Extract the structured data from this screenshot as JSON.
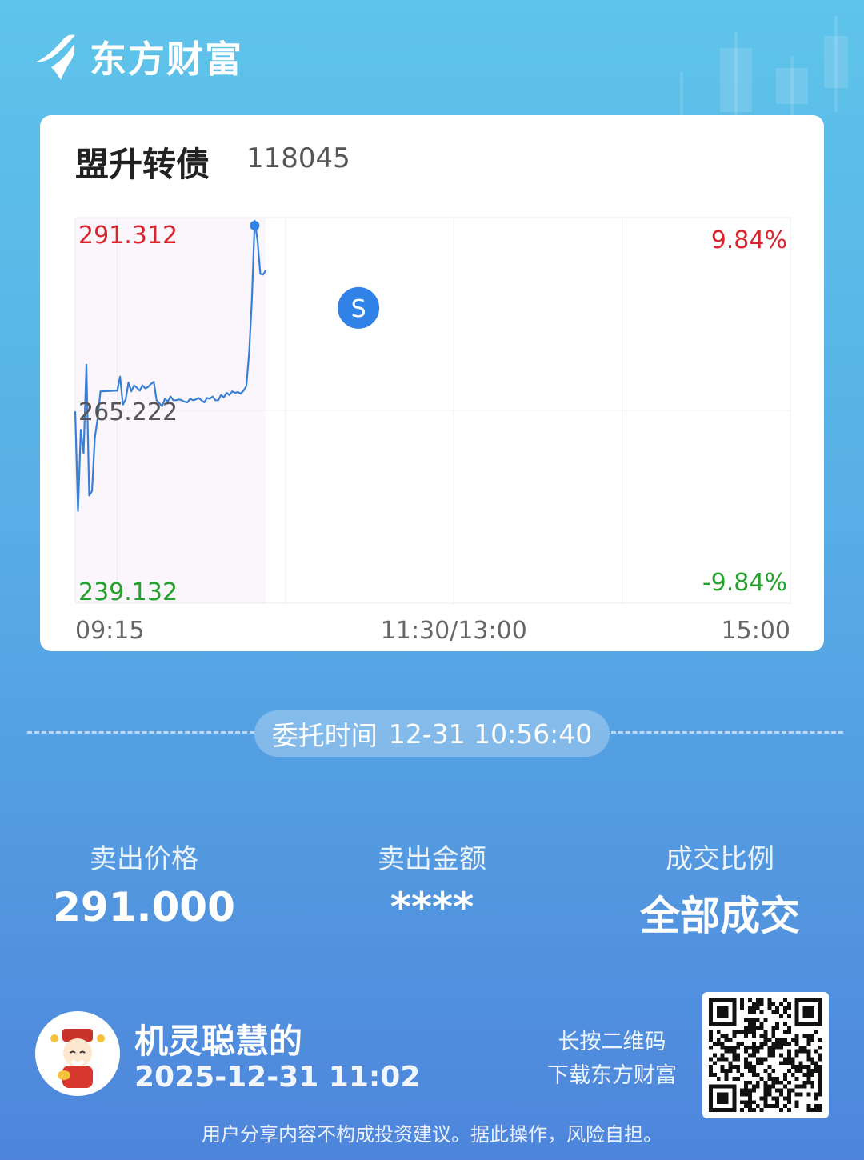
{
  "brand": {
    "name": "东方财富"
  },
  "stock": {
    "name": "盟升转债",
    "code": "118045"
  },
  "chart_data": {
    "type": "line",
    "y_labels": {
      "high": "291.312",
      "mid": "265.222",
      "low": "239.132"
    },
    "pct_labels": {
      "high": "9.84%",
      "low": "-9.84%"
    },
    "x_labels": [
      "09:15",
      "11:30/13:00",
      "15:00"
    ],
    "ylim": [
      239.132,
      291.312
    ],
    "prev_close": 265.222,
    "trade_marker": {
      "label": "S",
      "time": "10:56",
      "price": 291.0
    },
    "series": [
      {
        "values": [
          [
            "09:15",
            265.1
          ],
          [
            "09:16",
            251.6
          ],
          [
            "09:17",
            262.6
          ],
          [
            "09:18",
            259.4
          ],
          [
            "09:19",
            271.4
          ],
          [
            "09:20",
            253.7
          ],
          [
            "09:21",
            254.3
          ],
          [
            "09:22",
            261.5
          ],
          [
            "09:23",
            264.1
          ],
          [
            "09:24",
            267.8
          ],
          [
            "09:30",
            267.9
          ],
          [
            "09:31",
            269.8
          ],
          [
            "09:32",
            266.0
          ],
          [
            "09:33",
            266.7
          ],
          [
            "09:34",
            269.0
          ],
          [
            "09:35",
            267.8
          ],
          [
            "09:36",
            268.6
          ],
          [
            "09:37",
            268.3
          ],
          [
            "09:38",
            267.9
          ],
          [
            "09:39",
            268.6
          ],
          [
            "09:40",
            268.2
          ],
          [
            "09:41",
            268.4
          ],
          [
            "09:42",
            268.8
          ],
          [
            "09:43",
            269.1
          ],
          [
            "09:44",
            266.6
          ],
          [
            "09:45",
            266.2
          ],
          [
            "09:46",
            265.8
          ],
          [
            "09:47",
            266.8
          ],
          [
            "09:48",
            266.4
          ],
          [
            "09:49",
            267.1
          ],
          [
            "09:50",
            266.6
          ],
          [
            "09:51",
            266.6
          ],
          [
            "09:52",
            266.7
          ],
          [
            "09:53",
            266.6
          ],
          [
            "09:54",
            266.4
          ],
          [
            "09:55",
            266.3
          ],
          [
            "09:56",
            266.8
          ],
          [
            "09:57",
            266.6
          ],
          [
            "09:58",
            266.7
          ],
          [
            "09:59",
            266.9
          ],
          [
            "10:00",
            266.6
          ],
          [
            "10:01",
            266.3
          ],
          [
            "10:02",
            266.9
          ],
          [
            "10:03",
            266.8
          ],
          [
            "10:04",
            267.1
          ],
          [
            "10:05",
            266.6
          ],
          [
            "10:06",
            266.6
          ],
          [
            "10:07",
            267.3
          ],
          [
            "10:08",
            267.0
          ],
          [
            "10:09",
            267.6
          ],
          [
            "10:10",
            267.3
          ],
          [
            "10:11",
            267.8
          ],
          [
            "10:12",
            267.6
          ],
          [
            "10:13",
            267.7
          ],
          [
            "10:14",
            267.5
          ],
          [
            "10:15",
            267.9
          ],
          [
            "10:16",
            268.5
          ],
          [
            "10:17",
            273.0
          ],
          [
            "10:18",
            280.3
          ],
          [
            "10:19",
            290.9
          ],
          [
            "10:20",
            288.2
          ],
          [
            "10:21",
            283.7
          ],
          [
            "10:22",
            283.6
          ],
          [
            "10:23",
            284.2
          ]
        ]
      }
    ]
  },
  "order": {
    "label": "委托时间",
    "time": "12-31 10:56:40"
  },
  "stats": [
    {
      "label": "卖出价格",
      "value": "291.000"
    },
    {
      "label": "卖出金额",
      "value": "****"
    },
    {
      "label": "成交比例",
      "value": "全部成交"
    }
  ],
  "user": {
    "name": "机灵聪慧的",
    "time": "2025-12-31 11:02"
  },
  "qr": {
    "hint_line1": "长按二维码",
    "hint_line2": "下载东方财富"
  },
  "footer": {
    "disclaimer": "用户分享内容不构成投资建议。据此操作，风险自担。"
  },
  "colors": {
    "up": "#d9262e",
    "down": "#27a12e",
    "line": "#3a7fd5",
    "marker": "#3182e6"
  }
}
